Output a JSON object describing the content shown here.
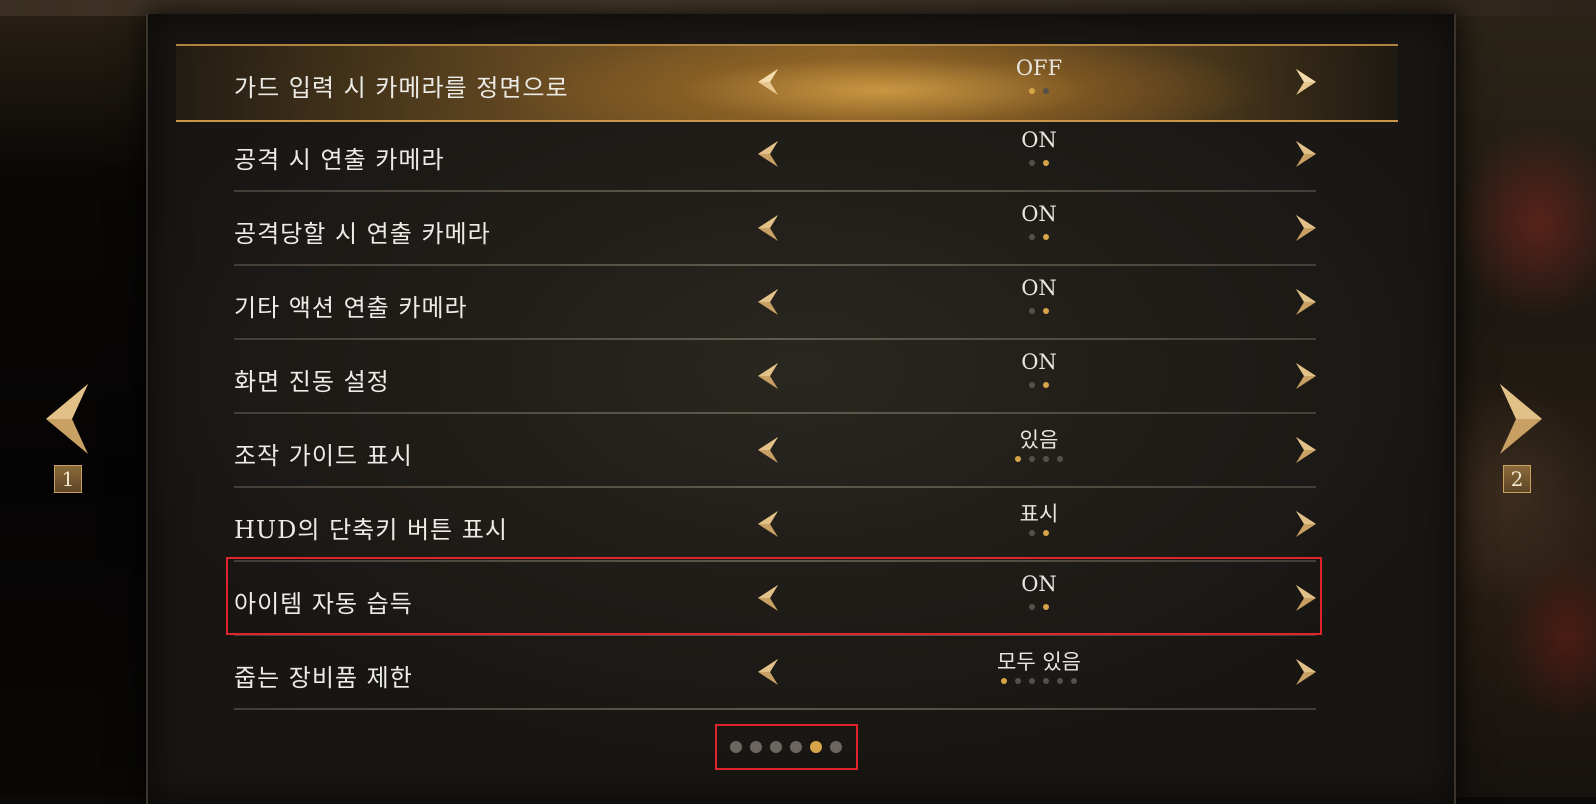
{
  "settings": [
    {
      "label": "가드 입력 시 카메라를 정면으로",
      "value": "OFF",
      "options": 2,
      "active": 0,
      "selected": true
    },
    {
      "label": "공격 시 연출 카메라",
      "value": "ON",
      "options": 2,
      "active": 1
    },
    {
      "label": "공격당할 시 연출 카메라",
      "value": "ON",
      "options": 2,
      "active": 1
    },
    {
      "label": "기타 액션 연출 카메라",
      "value": "ON",
      "options": 2,
      "active": 1
    },
    {
      "label": "화면 진동 설정",
      "value": "ON",
      "options": 2,
      "active": 1
    },
    {
      "label": "조작 가이드 표시",
      "value": "있음",
      "options": 4,
      "active": 0
    },
    {
      "label": "HUD의 단축키 버튼 표시",
      "value": "표시",
      "options": 2,
      "active": 1
    },
    {
      "label": "아이템 자동 습득",
      "value": "ON",
      "options": 2,
      "active": 1
    },
    {
      "label": "줍는 장비품 제한",
      "value": "모두 있음",
      "options": 6,
      "active": 0
    }
  ],
  "pager": {
    "pages": 6,
    "current": 4
  },
  "nav": {
    "prev_page": "1",
    "next_page": "2"
  },
  "colors": {
    "accent_gold": "#d7a548",
    "highlight_red": "#e0242b",
    "text": "#ecebe6"
  },
  "icons": {
    "left": "chevron-left-icon",
    "right": "chevron-right-icon"
  }
}
